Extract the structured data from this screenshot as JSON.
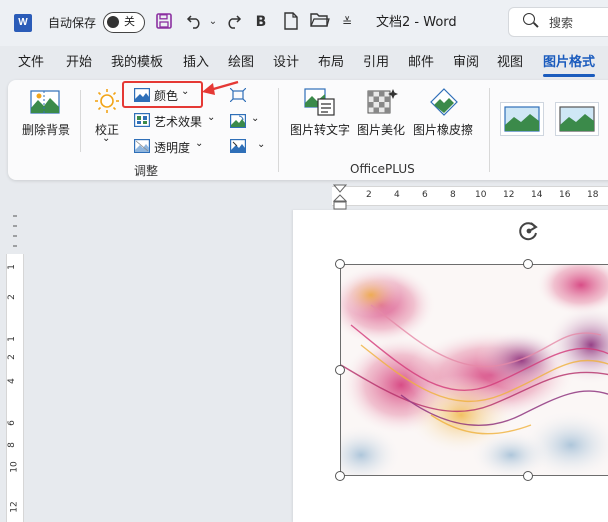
{
  "titlebar": {
    "app_badge": "W",
    "autosave_label": "自动保存",
    "autosave_state": "关",
    "save_icon": "save-icon",
    "undo_icon": "undo-icon",
    "redo_icon": "redo-icon",
    "bold_label": "B",
    "new_icon": "new-document-icon",
    "open_icon": "folder-open-icon",
    "more_label": "≚",
    "doc_title": "文档2 - Word",
    "search_placeholder": "搜索"
  },
  "tabs": [
    "文件",
    "开始",
    "我的模板",
    "插入",
    "绘图",
    "设计",
    "布局",
    "引用",
    "邮件",
    "审阅",
    "视图",
    "图片格式"
  ],
  "active_tab": "图片格式",
  "ribbon": {
    "remove_bg": "删除背景",
    "corrections": "校正",
    "color": "颜色",
    "artistic_effects": "艺术效果",
    "transparency": "透明度",
    "adjust_group": "调整",
    "pic_to_text": "图片转文字",
    "pic_beautify": "图片美化",
    "pic_eraser": "图片橡皮擦",
    "officeplus_group": "OfficePLUS"
  },
  "ruler": {
    "top_numbers": [
      "2",
      "4",
      "6",
      "8",
      "10",
      "12",
      "14",
      "16",
      "18"
    ],
    "left_numbers": [
      "1",
      "2",
      "1",
      "2",
      "4",
      "6",
      "8",
      "10",
      "12"
    ]
  },
  "colors": {
    "accent": "#1a5bbd",
    "highlight": "#e53935",
    "word_blue": "#2b5cb8",
    "save_purple": "#8b2fa0"
  }
}
